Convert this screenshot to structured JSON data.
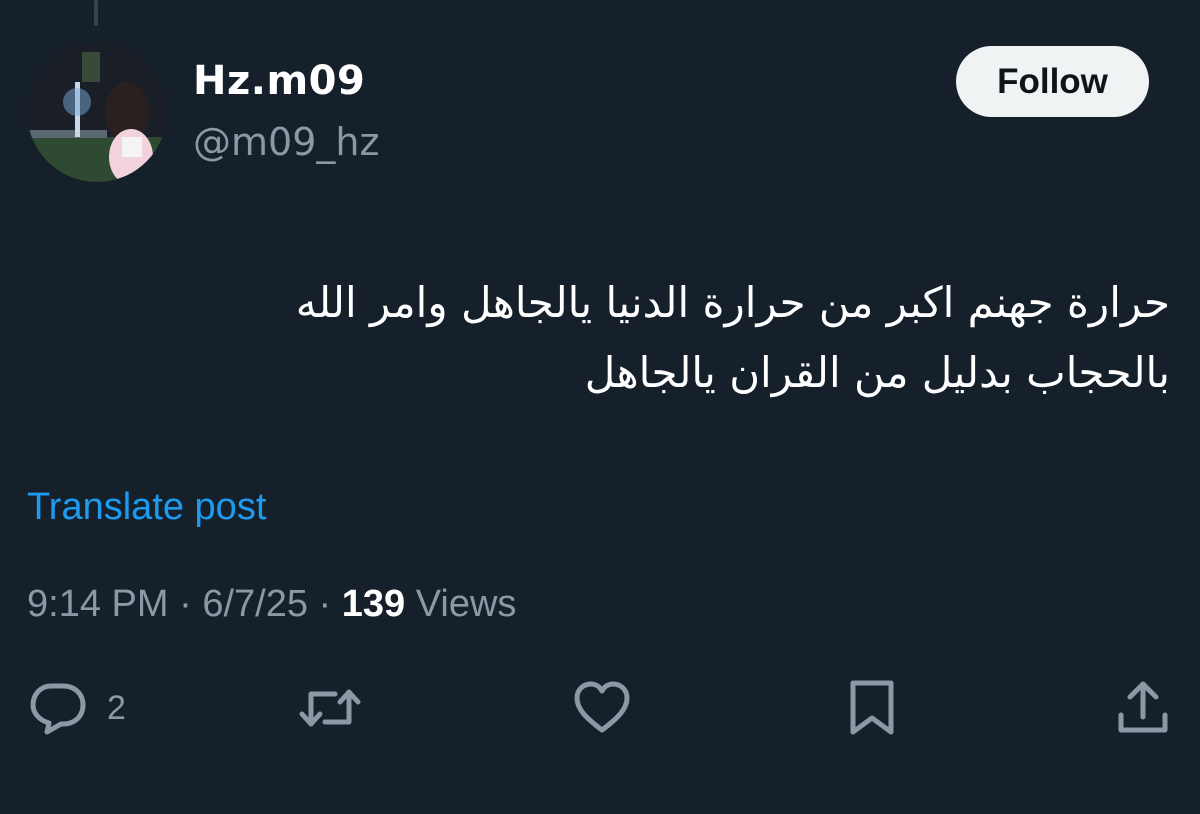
{
  "author": {
    "display_name": "Hz.m09",
    "handle": "@m09_hz",
    "avatar_icon": "profile-photo"
  },
  "follow_label": "Follow",
  "post": {
    "text_line1": "حرارة جهنم اكبر من حرارة الدنيا يالجاهل وامر الله",
    "text_line2": "بالحجاب بدليل من القران يالجاهل"
  },
  "translate_label": "Translate post",
  "meta": {
    "time": "9:14 PM",
    "separator": " · ",
    "date": "6/7/25",
    "views_count": "139",
    "views_label": " Views"
  },
  "actions": {
    "reply_count": "2",
    "icons": [
      "reply-icon",
      "repost-icon",
      "like-icon",
      "bookmark-icon",
      "share-icon"
    ]
  },
  "colors": {
    "background": "#15202b",
    "text": "#ffffff",
    "secondary": "#8b98a5",
    "link": "#1d9bf0",
    "button_bg": "#eff3f4"
  }
}
